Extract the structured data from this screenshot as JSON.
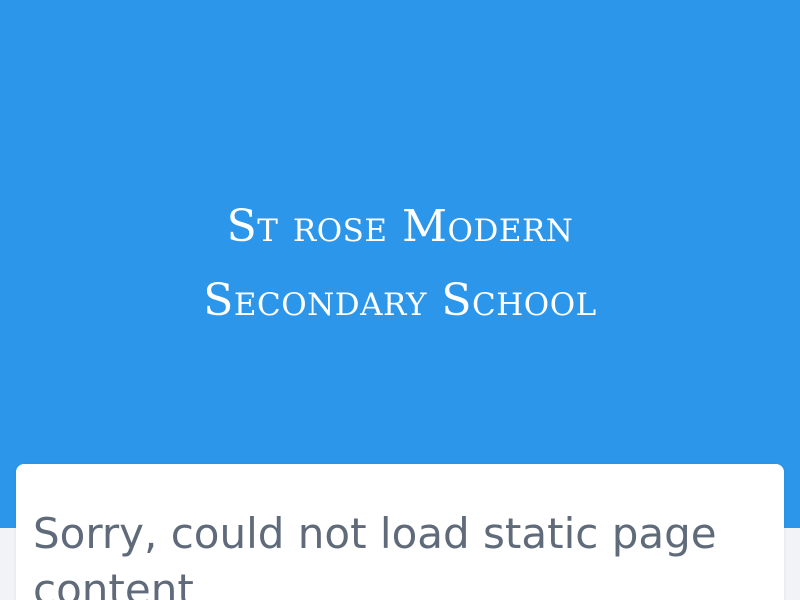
{
  "header": {
    "school_name_line1": "St rose Modern",
    "school_name_line2": "Secondary School",
    "background_color": "#2b96ea"
  },
  "content": {
    "error_message": "Sorry, could not load static page content"
  },
  "colors": {
    "page_background": "#f1f3f6",
    "card_background": "#ffffff",
    "message_text": "#5f6b7a"
  }
}
